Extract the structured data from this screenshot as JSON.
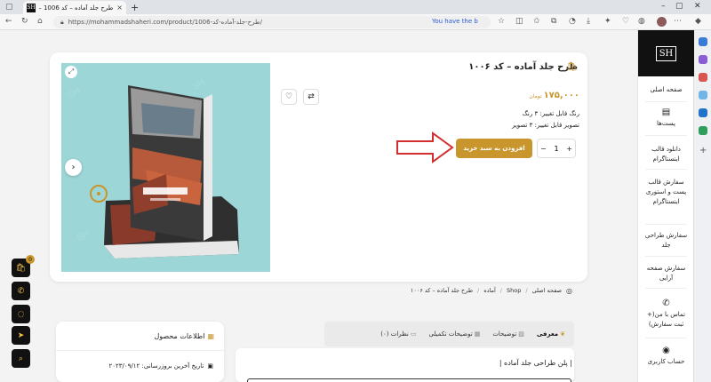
{
  "browser": {
    "tab_favicon": "SH",
    "tab_title": "طرح جلد آماده – کد 1006 – محمد",
    "url": "https://mohammadshaheri.com/product/1006-طرح-جلد-آماده-کد/",
    "promo": "You have the b",
    "new_tab": "+",
    "close_tab": "×"
  },
  "site": {
    "logo": "SH",
    "nav": [
      {
        "label": "صفحه اصلی",
        "icon": ""
      },
      {
        "label": "پست‌ها",
        "icon": "newspaper-icon"
      },
      {
        "label": "دانلود قالب اینستاگرام",
        "icon": ""
      },
      {
        "label": "سفارش قالب پست و استوری اینستاگرام",
        "icon": ""
      },
      {
        "label": "سفارش طراحی جلد",
        "icon": ""
      },
      {
        "label": "سفارش صفحه آرایی",
        "icon": ""
      },
      {
        "label": "تماس با من(+ ثبت سفارش)",
        "icon": "phone-icon"
      },
      {
        "label": "حساب کاربری",
        "icon": "user-icon"
      }
    ]
  },
  "product": {
    "title": "طرح جلد آماده – کد ۱۰۰۶",
    "price": "۱۷۵,۰۰۰",
    "currency": "تومان",
    "features": [
      "رنگ قابل تغییر: ۳ رنگ",
      "تصویر قابل تغییر: ۳ تصویر"
    ],
    "add_to_cart": "افزودن به سبد خرید",
    "quantity": "1",
    "minus": "−",
    "plus": "+"
  },
  "breadcrumb": [
    "صفحه اصلی",
    "Shop",
    "آماده",
    "طرح جلد آماده – کد ۱۰۰۶"
  ],
  "floating": {
    "cart_count": "0"
  },
  "info_box": {
    "title": "اطلاعات محصول",
    "row": "تاریخ آخرین بروزرسانی: ۲۰۲۳/۰۹/۱۲"
  },
  "tabs": [
    {
      "label": "معرفی",
      "active": true
    },
    {
      "label": "توضیحات",
      "active": false
    },
    {
      "label": "توضیحات تکمیلی",
      "active": false
    },
    {
      "label": "نظرات (۰)",
      "active": false
    }
  ],
  "content": {
    "title": "| پلن طراحی جلد آماده |"
  },
  "colors": {
    "accent": "#c9962e",
    "dark": "#111111",
    "teal": "#9dd6d6",
    "arrow": "#d32f2f"
  }
}
